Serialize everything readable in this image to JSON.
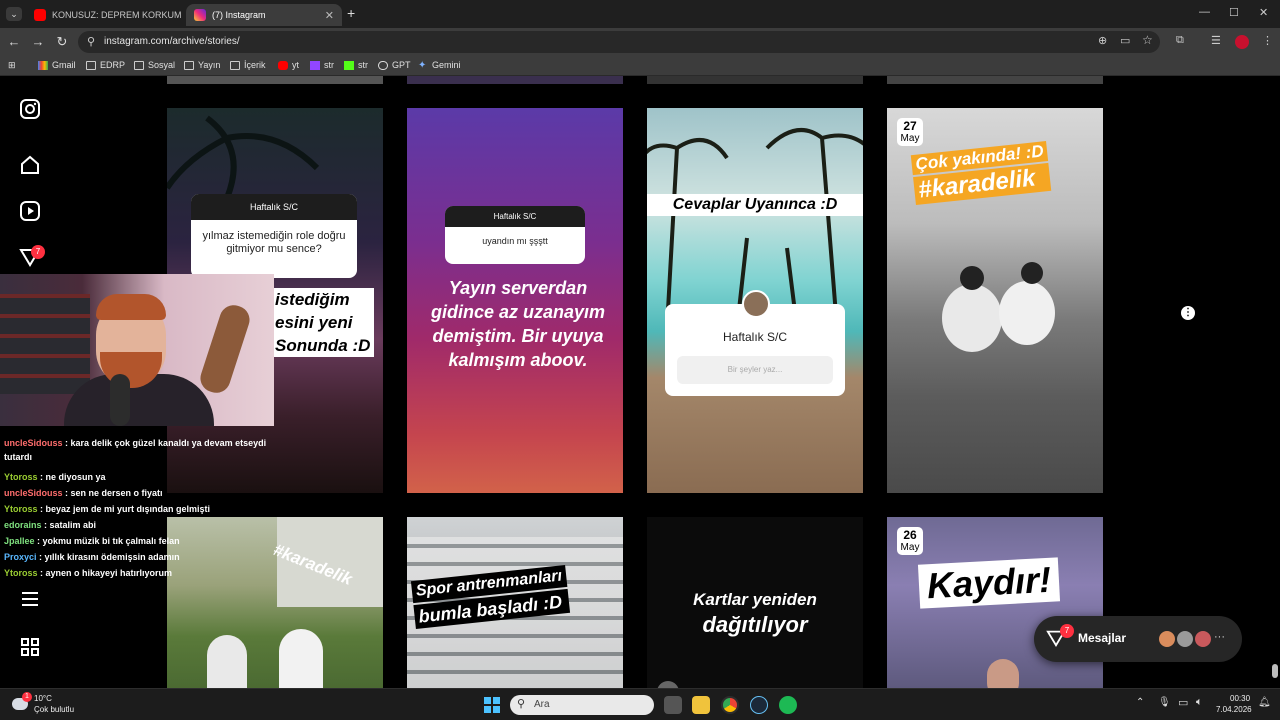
{
  "browser": {
    "tabs": [
      {
        "title": "KONUSUZ: DEPREM KORKUM, B",
        "active": false
      },
      {
        "title": "(7) Instagram",
        "active": true
      }
    ],
    "new_tab": "+",
    "url": "instagram.com/archive/stories/",
    "window_controls": [
      "—",
      "☐",
      "✕"
    ],
    "bookmarks": [
      {
        "label": "Gmail",
        "icon": "gmail-icon"
      },
      {
        "label": "EDRP",
        "icon": "folder-icon"
      },
      {
        "label": "Sosyal",
        "icon": "folder-icon"
      },
      {
        "label": "Yayın",
        "icon": "folder-icon"
      },
      {
        "label": "İçerik",
        "icon": "folder-icon"
      },
      {
        "label": "yt",
        "icon": "youtube-icon"
      },
      {
        "label": "str",
        "icon": "twitch-icon"
      },
      {
        "label": "str",
        "icon": "kick-icon"
      },
      {
        "label": "GPT",
        "icon": "chatgpt-icon"
      },
      {
        "label": "Gemini",
        "icon": "gemini-icon"
      }
    ]
  },
  "sidebar": {
    "notification_count": "7"
  },
  "stories": {
    "card1": {
      "question_title": "Haftalık S/C",
      "question_text": "yılmaz istemediğin role doğru gitmiyor mu sence?",
      "text_line1": "istediğim",
      "text_line2": "esini yeni",
      "text_line3": "Sonunda :D"
    },
    "card2": {
      "question_title": "Haftalık S/C",
      "question_text": "uyandın mı şşştt",
      "text": "Yayın serverdan gidince az uzanayım demiştim. Bir uyuya kalmışım aboov."
    },
    "card3": {
      "headline": "Cevaplar Uyanınca :D",
      "box_title": "Haftalık S/C",
      "box_placeholder": "Bir şeyler yaz..."
    },
    "card4": {
      "date_day": "27",
      "date_month": "May",
      "line1": "Çok yakında! :D",
      "line2": "#karadelik"
    },
    "card5": {
      "hashtag": "#karadelik"
    },
    "card6": {
      "line1": "Spor antrenmanları",
      "line2": "bumla başladı :D"
    },
    "card7": {
      "line1": "Kartlar yeniden",
      "line2": "dağıtılıyor"
    },
    "card8": {
      "date_day": "26",
      "date_month": "May",
      "text": "Kaydır!"
    }
  },
  "chat": {
    "messages": [
      {
        "user": "uncleSidouss",
        "text": ": kara delik çok güzel kanaldı ya devam etseydi",
        "cont": "tutardı",
        "color": "#ff6d6d"
      },
      {
        "user": "Ytoross",
        "text": ": ne diyosun ya",
        "color": "#9acd32"
      },
      {
        "user": "uncleSidouss",
        "text": ": sen ne dersen o fiyatı",
        "color": "#ff6d6d"
      },
      {
        "user": "Ytoross",
        "text": ": beyaz jem de mi yurt dışından gelmişti",
        "color": "#9acd32"
      },
      {
        "user": "edorains",
        "text": ": satalim abi",
        "color": "#7fe07f"
      },
      {
        "user": "Jpallee",
        "text": ": yokmu müzik bi tık çalmalı felan",
        "color": "#7fe07f"
      },
      {
        "user": "Proxyci",
        "text": ": yıllık kirasını ödemişsin adamın",
        "color": "#5ab8ff"
      },
      {
        "user": "Ytoross",
        "text": ": aynen o hikayeyi hatırlıyorum",
        "color": "#9acd32"
      }
    ]
  },
  "messages_panel": {
    "label": "Mesajlar",
    "badge": "7",
    "more": "···"
  },
  "taskbar": {
    "weather_temp": "10°C",
    "weather_desc": "Çok bulutlu",
    "weather_badge": "1",
    "search_placeholder": "Ara",
    "time": "00:30",
    "date": "7.04.2026"
  }
}
